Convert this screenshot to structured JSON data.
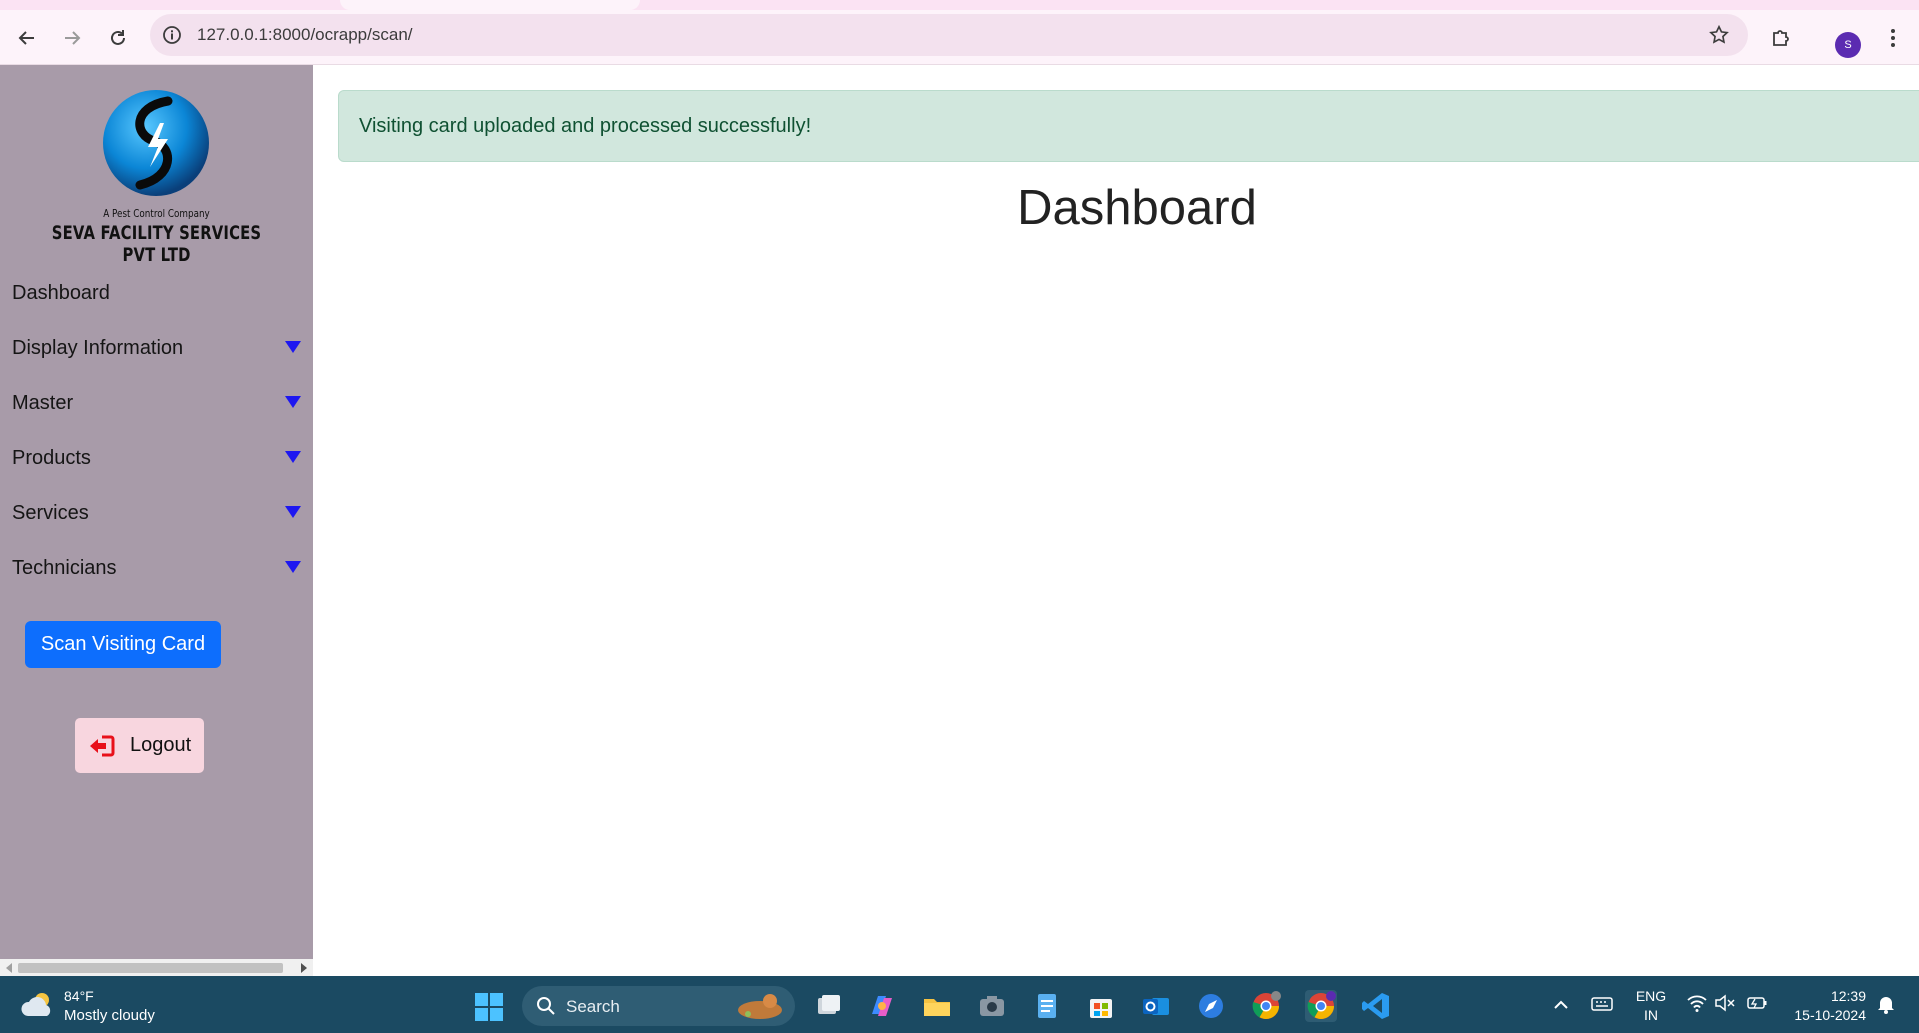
{
  "browser": {
    "url": "127.0.0.1:8000/ocrapp/scan/",
    "profile_initial": "S"
  },
  "sidebar": {
    "tagline": "A Pest Control Company",
    "company_name": "SEVA FACILITY SERVICES PVT LTD",
    "items": [
      {
        "label": "Dashboard",
        "has_dropdown": false
      },
      {
        "label": "Display Information",
        "has_dropdown": true
      },
      {
        "label": "Master",
        "has_dropdown": true
      },
      {
        "label": "Products",
        "has_dropdown": true
      },
      {
        "label": "Services",
        "has_dropdown": true
      },
      {
        "label": "Technicians",
        "has_dropdown": true
      }
    ],
    "scan_button_label": "Scan Visiting Card",
    "logout_label": "Logout"
  },
  "main": {
    "alert_message": "Visiting card uploaded and processed successfully!",
    "title": "Dashboard"
  },
  "taskbar": {
    "weather_temp": "84°F",
    "weather_desc": "Mostly cloudy",
    "search_label": "Search",
    "language": "ENG",
    "region": "IN",
    "time": "12:39",
    "date": "15-10-2024"
  },
  "colors": {
    "sidebar_bg": "#a89ba9",
    "alert_bg": "#d1e7dd",
    "alert_text": "#0f5132",
    "primary_button": "#0d6efd",
    "caret": "#1d17f0",
    "taskbar_bg": "#1b4a62"
  }
}
